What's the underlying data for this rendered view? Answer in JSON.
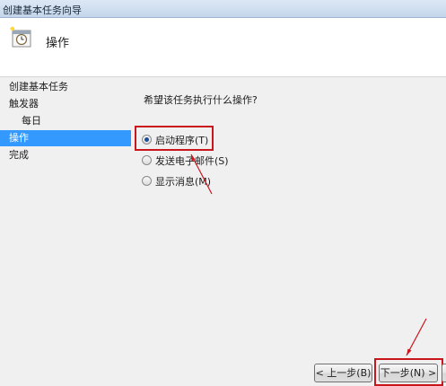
{
  "window": {
    "title": "创建基本任务向导"
  },
  "header": {
    "title": "操作"
  },
  "sidebar": {
    "items": [
      {
        "label": "创建基本任务"
      },
      {
        "label": "触发器"
      },
      {
        "label": "每日"
      },
      {
        "label": "操作"
      },
      {
        "label": "完成"
      }
    ]
  },
  "main": {
    "question": "希望该任务执行什么操作?",
    "options": [
      {
        "label": "启动程序(T)",
        "selected": true
      },
      {
        "label": "发送电子邮件(S)",
        "selected": false
      },
      {
        "label": "显示消息(M)",
        "selected": false
      }
    ]
  },
  "footer": {
    "back_label": "< 上一步(B)",
    "next_label": "下一步(N) >"
  },
  "annotation": {
    "color": "#c9161d"
  }
}
